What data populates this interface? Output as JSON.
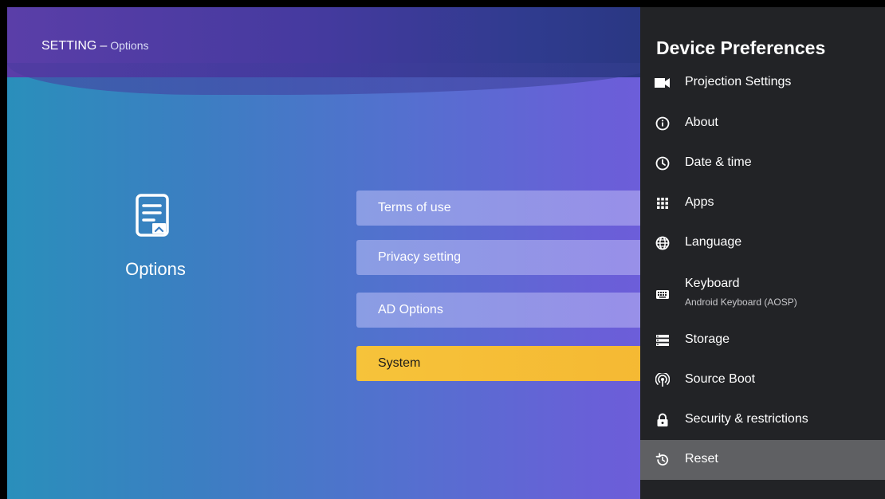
{
  "header": {
    "title": "SETTING",
    "separator": "–",
    "subtitle": "Options"
  },
  "left": {
    "icon": "document-icon",
    "title": "Options"
  },
  "menu": {
    "items": [
      {
        "label": "Terms of use",
        "active": false
      },
      {
        "label": "Privacy setting",
        "active": false
      },
      {
        "label": "AD Options",
        "active": false
      },
      {
        "label": "System",
        "active": true
      }
    ]
  },
  "panel": {
    "title": "Device Preferences",
    "items": [
      {
        "label": "Projection Settings",
        "icon": "projector-icon"
      },
      {
        "label": "About",
        "icon": "info-icon"
      },
      {
        "label": "Date & time",
        "icon": "clock-icon"
      },
      {
        "label": "Apps",
        "icon": "apps-grid-icon"
      },
      {
        "label": "Language",
        "icon": "globe-icon"
      },
      {
        "label": "Keyboard",
        "sublabel": "Android Keyboard (AOSP)",
        "icon": "keyboard-icon"
      },
      {
        "label": "Storage",
        "icon": "storage-icon"
      },
      {
        "label": "Source Boot",
        "icon": "source-boot-icon"
      },
      {
        "label": "Security & restrictions",
        "icon": "lock-icon"
      },
      {
        "label": "Reset",
        "icon": "reset-icon",
        "highlighted": true
      }
    ]
  },
  "colors": {
    "active_button": "#f6c33a",
    "panel_background": "#222326",
    "highlight_row": "#5f6063"
  }
}
